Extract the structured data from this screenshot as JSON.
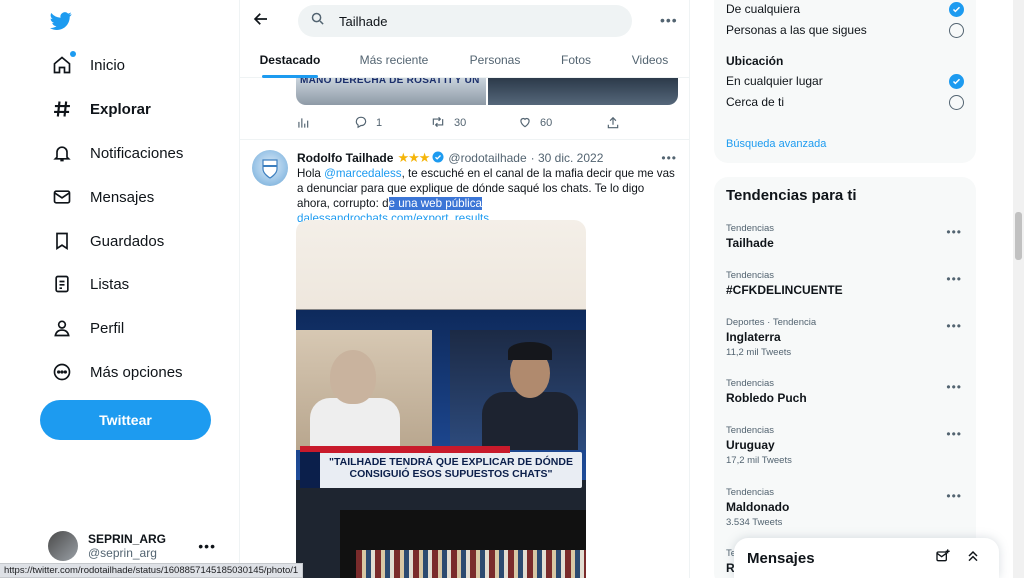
{
  "nav": {
    "items": [
      {
        "label": "Inicio",
        "icon": "home-icon"
      },
      {
        "label": "Explorar",
        "icon": "hashtag-icon"
      },
      {
        "label": "Notificaciones",
        "icon": "bell-icon"
      },
      {
        "label": "Mensajes",
        "icon": "mail-icon"
      },
      {
        "label": "Guardados",
        "icon": "bookmark-icon"
      },
      {
        "label": "Listas",
        "icon": "list-icon"
      },
      {
        "label": "Perfil",
        "icon": "person-icon"
      },
      {
        "label": "Más opciones",
        "icon": "more-circle-icon"
      }
    ],
    "tweet_button": "Twittear"
  },
  "account": {
    "name": "SEPRIN_ARG",
    "handle": "@seprin_arg"
  },
  "search": {
    "query": "Tailhade"
  },
  "tabs": [
    "Destacado",
    "Más reciente",
    "Personas",
    "Fotos",
    "Videos"
  ],
  "prev_tweet": {
    "media_caption": "MANO DERECHA DE ROSATTI Y UN",
    "replies": "1",
    "retweets": "30",
    "likes": "60"
  },
  "tweet": {
    "name": "Rodolfo Tailhade",
    "stars": "★★★",
    "handle": "@rodotailhade",
    "date": "· 30 dic. 2022",
    "text_part1": "Hola ",
    "mention": "@marcedaless",
    "text_part2": ", te escuché en el canal de la mafia decir que me vas a denunciar para que explique de dónde saqué los chats. Te lo digo ahora, corrupto: d",
    "highlighted": "e una web pública",
    "text_part3": " ",
    "link": "dalessandrochats.com/export_results…",
    "media_caption": "\"TAILHADE TENDRÁ QUE EXPLICAR DE DÓNDE CONSIGUIÓ ESOS SUPUESTOS CHATS\""
  },
  "filters": {
    "people_options": [
      {
        "label": "De cualquiera",
        "checked": true
      },
      {
        "label": "Personas a las que sigues",
        "checked": false
      }
    ],
    "location_title": "Ubicación",
    "location_options": [
      {
        "label": "En cualquier lugar",
        "checked": true
      },
      {
        "label": "Cerca de ti",
        "checked": false
      }
    ],
    "advanced_search": "Búsqueda avanzada"
  },
  "trends": {
    "title": "Tendencias para ti",
    "items": [
      {
        "context": "Tendencias",
        "name": "Tailhade",
        "count": ""
      },
      {
        "context": "Tendencias",
        "name": "#CFKDELINCUENTE",
        "count": ""
      },
      {
        "context": "Deportes · Tendencia",
        "name": "Inglaterra",
        "count": "11,2 mil Tweets"
      },
      {
        "context": "Tendencias",
        "name": "Robledo Puch",
        "count": ""
      },
      {
        "context": "Tendencias",
        "name": "Uruguay",
        "count": "17,2 mil Tweets"
      },
      {
        "context": "Tendencias",
        "name": "Maldonado",
        "count": "3.534 Tweets"
      },
      {
        "context": "Te",
        "name": "Ra",
        "count": ""
      }
    ]
  },
  "messages_drawer": {
    "title": "Mensajes"
  },
  "status_url": "https://twitter.com/rodotailhade/status/1608857145185030145/photo/1",
  "colors": {
    "accent": "#1d9bf0",
    "text": "#0f1419",
    "muted": "#536471",
    "panel": "#f7f9f9"
  }
}
